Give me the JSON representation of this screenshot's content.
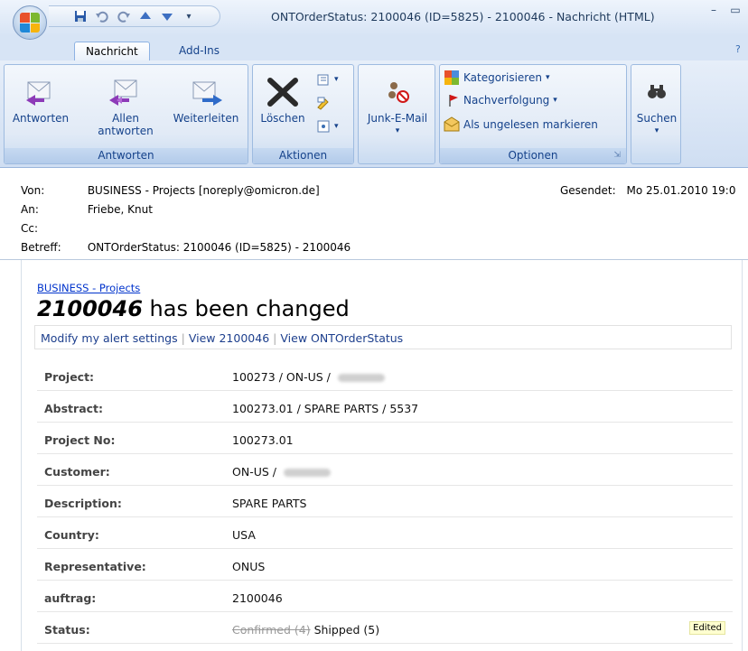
{
  "window": {
    "title": "ONTOrderStatus: 2100046 (ID=5825) - 2100046 - Nachricht (HTML)"
  },
  "tabs": [
    {
      "label": "Nachricht",
      "active": true
    },
    {
      "label": "Add-Ins",
      "active": false
    }
  ],
  "ribbon": {
    "antworten": {
      "label": "Antworten",
      "reply": "Antworten",
      "reply_all_1": "Allen",
      "reply_all_2": "antworten",
      "forward": "Weiterleiten"
    },
    "aktionen": {
      "label": "Aktionen",
      "delete": "Löschen"
    },
    "junk": {
      "label": "Junk-E-Mail"
    },
    "optionen": {
      "label": "Optionen",
      "categorize": "Kategorisieren",
      "followup": "Nachverfolgung",
      "mark_unread": "Als ungelesen markieren"
    },
    "suchen": {
      "label": "Suchen"
    }
  },
  "header": {
    "from_label": "Von:",
    "from_value": "BUSINESS - Projects [noreply@omicron.de]",
    "sent_label": "Gesendet:",
    "sent_value": "Mo 25.01.2010 19:0",
    "to_label": "An:",
    "to_value": "Friebe, Knut",
    "cc_label": "Cc:",
    "subject_label": "Betreff:",
    "subject_value": "ONTOrderStatus: 2100046 (ID=5825) - 2100046"
  },
  "message": {
    "breadcrumb": "BUSINESS - Projects",
    "headline_bold": "2100046",
    "headline_rest": " has been changed",
    "links": [
      "Modify my alert settings",
      "View 2100046",
      "View ONTOrderStatus"
    ],
    "fields": [
      {
        "key": "Project:",
        "value": "100273 / ON-US / ",
        "blurred": true
      },
      {
        "key": "Abstract:",
        "value": "100273.01 / SPARE PARTS / 5537"
      },
      {
        "key": "Project No:",
        "value": "100273.01"
      },
      {
        "key": "Customer:",
        "value": "ON-US / ",
        "blurred": true
      },
      {
        "key": "Description:",
        "value": "SPARE PARTS"
      },
      {
        "key": "Country:",
        "value": "USA"
      },
      {
        "key": "Representative:",
        "value": "ONUS"
      },
      {
        "key": "auftrag:",
        "value": "2100046"
      },
      {
        "key": "Status:",
        "old": "Confirmed (4)",
        "value": "Shipped (5)",
        "badge": "Edited"
      }
    ]
  }
}
